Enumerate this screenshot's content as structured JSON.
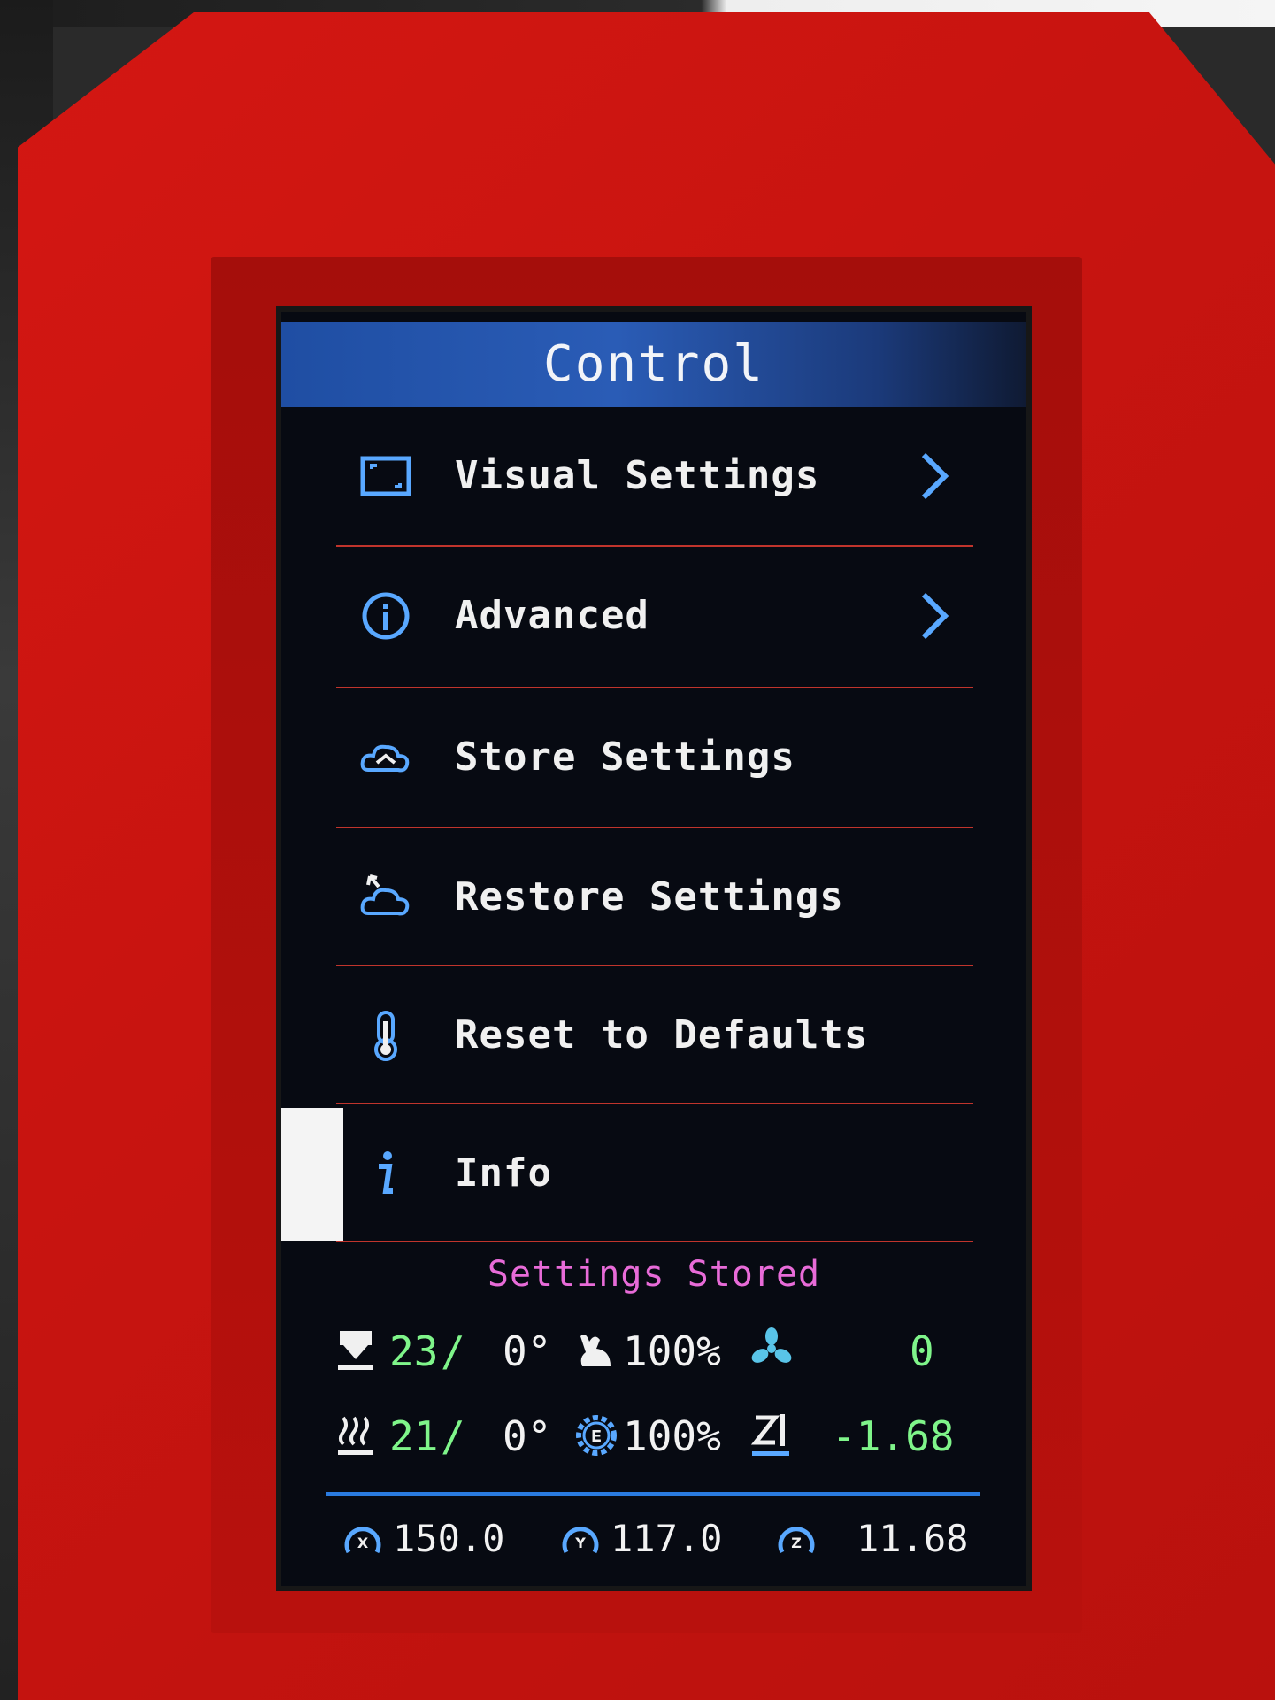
{
  "header": {
    "title": "Control"
  },
  "menu": {
    "items": [
      {
        "label": "Visual Settings",
        "icon": "display-icon",
        "has_submenu": true
      },
      {
        "label": "Advanced",
        "icon": "info-circle-icon",
        "has_submenu": true
      },
      {
        "label": "Store Settings",
        "icon": "cloud-store-icon",
        "has_submenu": false
      },
      {
        "label": "Restore Settings",
        "icon": "cloud-restore-icon",
        "has_submenu": false
      },
      {
        "label": "Reset to Defaults",
        "icon": "thermometer-icon",
        "has_submenu": false
      },
      {
        "label": "Info",
        "icon": "info-icon",
        "has_submenu": false,
        "selected": true
      }
    ]
  },
  "status_message": "Settings Stored",
  "status": {
    "hotend_temp": "23",
    "hotend_target": "0°",
    "feedrate": "100%",
    "fan": "0",
    "bed_temp": "21",
    "bed_target": "0°",
    "flow": "100%",
    "z_offset": "-1.68",
    "temp_separator": "/"
  },
  "position": {
    "x": "150.0",
    "y": "117.0",
    "z": "11.68"
  },
  "colors": {
    "accent_blue": "#2a5cb6",
    "divider_red": "#c0342c",
    "message_pink": "#e86bd8",
    "value_green": "#7ff58a",
    "case_red": "#d41712"
  }
}
